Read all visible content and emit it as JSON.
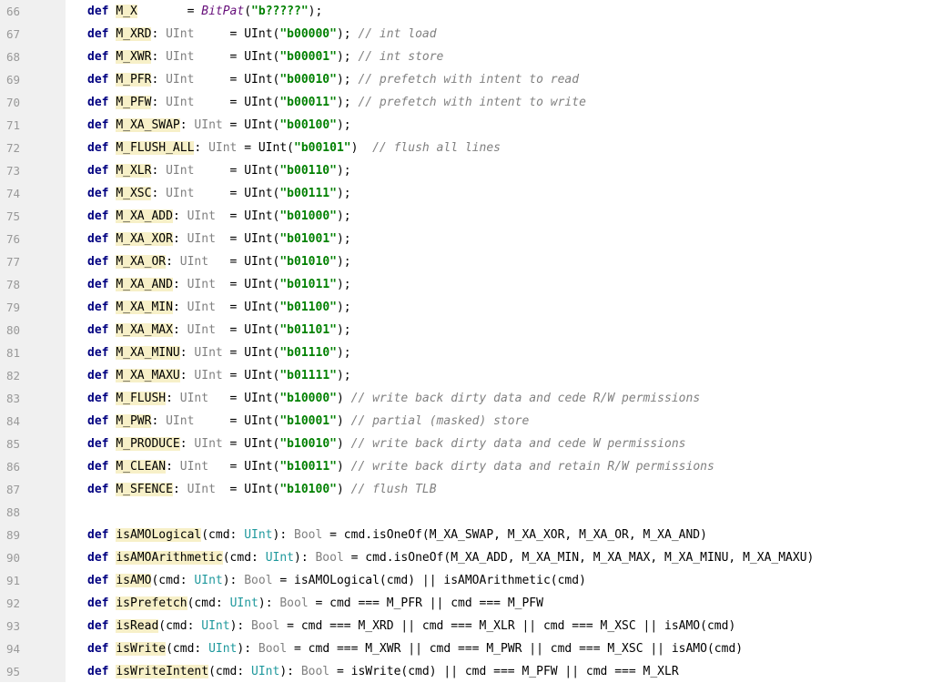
{
  "editor": {
    "first_line_number": 66,
    "lines": [
      [
        [
          "kw",
          "def"
        ],
        [
          "pl",
          " "
        ],
        [
          "id",
          "M_X"
        ],
        [
          "pl",
          "       = "
        ],
        [
          "it",
          "BitPat"
        ],
        [
          "pl",
          "("
        ],
        [
          "str",
          "\"b?????\""
        ],
        [
          "pl",
          ");"
        ]
      ],
      [
        [
          "kw",
          "def"
        ],
        [
          "pl",
          " "
        ],
        [
          "id",
          "M_XRD"
        ],
        [
          "pl",
          ": "
        ],
        [
          "ty",
          "UInt"
        ],
        [
          "pl",
          "     = UInt("
        ],
        [
          "str",
          "\"b00000\""
        ],
        [
          "pl",
          ");"
        ],
        [
          "cmt",
          " // int load"
        ]
      ],
      [
        [
          "kw",
          "def"
        ],
        [
          "pl",
          " "
        ],
        [
          "id",
          "M_XWR"
        ],
        [
          "pl",
          ": "
        ],
        [
          "ty",
          "UInt"
        ],
        [
          "pl",
          "     = UInt("
        ],
        [
          "str",
          "\"b00001\""
        ],
        [
          "pl",
          ");"
        ],
        [
          "cmt",
          " // int store"
        ]
      ],
      [
        [
          "kw",
          "def"
        ],
        [
          "pl",
          " "
        ],
        [
          "id",
          "M_PFR"
        ],
        [
          "pl",
          ": "
        ],
        [
          "ty",
          "UInt"
        ],
        [
          "pl",
          "     = UInt("
        ],
        [
          "str",
          "\"b00010\""
        ],
        [
          "pl",
          ");"
        ],
        [
          "cmt",
          " // prefetch with intent to read"
        ]
      ],
      [
        [
          "kw",
          "def"
        ],
        [
          "pl",
          " "
        ],
        [
          "id",
          "M_PFW"
        ],
        [
          "pl",
          ": "
        ],
        [
          "ty",
          "UInt"
        ],
        [
          "pl",
          "     = UInt("
        ],
        [
          "str",
          "\"b00011\""
        ],
        [
          "pl",
          ");"
        ],
        [
          "cmt",
          " // prefetch with intent to write"
        ]
      ],
      [
        [
          "kw",
          "def"
        ],
        [
          "pl",
          " "
        ],
        [
          "id",
          "M_XA_SWAP"
        ],
        [
          "pl",
          ": "
        ],
        [
          "ty",
          "UInt"
        ],
        [
          "pl",
          " = UInt("
        ],
        [
          "str",
          "\"b00100\""
        ],
        [
          "pl",
          ");"
        ]
      ],
      [
        [
          "kw",
          "def"
        ],
        [
          "pl",
          " "
        ],
        [
          "id",
          "M_FLUSH_ALL"
        ],
        [
          "pl",
          ": "
        ],
        [
          "ty",
          "UInt"
        ],
        [
          "pl",
          " = UInt("
        ],
        [
          "str",
          "\"b00101\""
        ],
        [
          "pl",
          ")"
        ],
        [
          "cmt",
          "  // flush all lines"
        ]
      ],
      [
        [
          "kw",
          "def"
        ],
        [
          "pl",
          " "
        ],
        [
          "id",
          "M_XLR"
        ],
        [
          "pl",
          ": "
        ],
        [
          "ty",
          "UInt"
        ],
        [
          "pl",
          "     = UInt("
        ],
        [
          "str",
          "\"b00110\""
        ],
        [
          "pl",
          ");"
        ]
      ],
      [
        [
          "kw",
          "def"
        ],
        [
          "pl",
          " "
        ],
        [
          "id",
          "M_XSC"
        ],
        [
          "pl",
          ": "
        ],
        [
          "ty",
          "UInt"
        ],
        [
          "pl",
          "     = UInt("
        ],
        [
          "str",
          "\"b00111\""
        ],
        [
          "pl",
          ");"
        ]
      ],
      [
        [
          "kw",
          "def"
        ],
        [
          "pl",
          " "
        ],
        [
          "id",
          "M_XA_ADD"
        ],
        [
          "pl",
          ": "
        ],
        [
          "ty",
          "UInt"
        ],
        [
          "pl",
          "  = UInt("
        ],
        [
          "str",
          "\"b01000\""
        ],
        [
          "pl",
          ");"
        ]
      ],
      [
        [
          "kw",
          "def"
        ],
        [
          "pl",
          " "
        ],
        [
          "id",
          "M_XA_XOR"
        ],
        [
          "pl",
          ": "
        ],
        [
          "ty",
          "UInt"
        ],
        [
          "pl",
          "  = UInt("
        ],
        [
          "str",
          "\"b01001\""
        ],
        [
          "pl",
          ");"
        ]
      ],
      [
        [
          "kw",
          "def"
        ],
        [
          "pl",
          " "
        ],
        [
          "id",
          "M_XA_OR"
        ],
        [
          "pl",
          ": "
        ],
        [
          "ty",
          "UInt"
        ],
        [
          "pl",
          "   = UInt("
        ],
        [
          "str",
          "\"b01010\""
        ],
        [
          "pl",
          ");"
        ]
      ],
      [
        [
          "kw",
          "def"
        ],
        [
          "pl",
          " "
        ],
        [
          "id",
          "M_XA_AND"
        ],
        [
          "pl",
          ": "
        ],
        [
          "ty",
          "UInt"
        ],
        [
          "pl",
          "  = UInt("
        ],
        [
          "str",
          "\"b01011\""
        ],
        [
          "pl",
          ");"
        ]
      ],
      [
        [
          "kw",
          "def"
        ],
        [
          "pl",
          " "
        ],
        [
          "id",
          "M_XA_MIN"
        ],
        [
          "pl",
          ": "
        ],
        [
          "ty",
          "UInt"
        ],
        [
          "pl",
          "  = UInt("
        ],
        [
          "str",
          "\"b01100\""
        ],
        [
          "pl",
          ");"
        ]
      ],
      [
        [
          "kw",
          "def"
        ],
        [
          "pl",
          " "
        ],
        [
          "id",
          "M_XA_MAX"
        ],
        [
          "pl",
          ": "
        ],
        [
          "ty",
          "UInt"
        ],
        [
          "pl",
          "  = UInt("
        ],
        [
          "str",
          "\"b01101\""
        ],
        [
          "pl",
          ");"
        ]
      ],
      [
        [
          "kw",
          "def"
        ],
        [
          "pl",
          " "
        ],
        [
          "id",
          "M_XA_MINU"
        ],
        [
          "pl",
          ": "
        ],
        [
          "ty",
          "UInt"
        ],
        [
          "pl",
          " = UInt("
        ],
        [
          "str",
          "\"b01110\""
        ],
        [
          "pl",
          ");"
        ]
      ],
      [
        [
          "kw",
          "def"
        ],
        [
          "pl",
          " "
        ],
        [
          "id",
          "M_XA_MAXU"
        ],
        [
          "pl",
          ": "
        ],
        [
          "ty",
          "UInt"
        ],
        [
          "pl",
          " = UInt("
        ],
        [
          "str",
          "\"b01111\""
        ],
        [
          "pl",
          ");"
        ]
      ],
      [
        [
          "kw",
          "def"
        ],
        [
          "pl",
          " "
        ],
        [
          "id",
          "M_FLUSH"
        ],
        [
          "pl",
          ": "
        ],
        [
          "ty",
          "UInt"
        ],
        [
          "pl",
          "   = UInt("
        ],
        [
          "str",
          "\"b10000\""
        ],
        [
          "pl",
          ")"
        ],
        [
          "cmt",
          " // write back dirty data and cede R/W permissions"
        ]
      ],
      [
        [
          "kw",
          "def"
        ],
        [
          "pl",
          " "
        ],
        [
          "id",
          "M_PWR"
        ],
        [
          "pl",
          ": "
        ],
        [
          "ty",
          "UInt"
        ],
        [
          "pl",
          "     = UInt("
        ],
        [
          "str",
          "\"b10001\""
        ],
        [
          "pl",
          ")"
        ],
        [
          "cmt",
          " // partial (masked) store"
        ]
      ],
      [
        [
          "kw",
          "def"
        ],
        [
          "pl",
          " "
        ],
        [
          "id",
          "M_PRODUCE"
        ],
        [
          "pl",
          ": "
        ],
        [
          "ty",
          "UInt"
        ],
        [
          "pl",
          " = UInt("
        ],
        [
          "str",
          "\"b10010\""
        ],
        [
          "pl",
          ")"
        ],
        [
          "cmt",
          " // write back dirty data and cede W permissions"
        ]
      ],
      [
        [
          "kw",
          "def"
        ],
        [
          "pl",
          " "
        ],
        [
          "id",
          "M_CLEAN"
        ],
        [
          "pl",
          ": "
        ],
        [
          "ty",
          "UInt"
        ],
        [
          "pl",
          "   = UInt("
        ],
        [
          "str",
          "\"b10011\""
        ],
        [
          "pl",
          ")"
        ],
        [
          "cmt",
          " // write back dirty data and retain R/W permissions"
        ]
      ],
      [
        [
          "kw",
          "def"
        ],
        [
          "pl",
          " "
        ],
        [
          "id",
          "M_SFENCE"
        ],
        [
          "pl",
          ": "
        ],
        [
          "ty",
          "UInt"
        ],
        [
          "pl",
          "  = UInt("
        ],
        [
          "str",
          "\"b10100\""
        ],
        [
          "pl",
          ")"
        ],
        [
          "cmt",
          " // flush TLB"
        ]
      ],
      [],
      [
        [
          "kw",
          "def"
        ],
        [
          "pl",
          " "
        ],
        [
          "id",
          "isAMOLogical"
        ],
        [
          "pl",
          "(cmd: "
        ],
        [
          "tyb",
          "UInt"
        ],
        [
          "pl",
          "): "
        ],
        [
          "ty",
          "Bool"
        ],
        [
          "pl",
          " = cmd.isOneOf(M_XA_SWAP, M_XA_XOR, M_XA_OR, M_XA_AND)"
        ]
      ],
      [
        [
          "kw",
          "def"
        ],
        [
          "pl",
          " "
        ],
        [
          "id",
          "isAMOArithmetic"
        ],
        [
          "pl",
          "(cmd: "
        ],
        [
          "tyb",
          "UInt"
        ],
        [
          "pl",
          "): "
        ],
        [
          "ty",
          "Bool"
        ],
        [
          "pl",
          " = cmd.isOneOf(M_XA_ADD, M_XA_MIN, M_XA_MAX, M_XA_MINU, M_XA_MAXU)"
        ]
      ],
      [
        [
          "kw",
          "def"
        ],
        [
          "pl",
          " "
        ],
        [
          "id",
          "isAMO"
        ],
        [
          "pl",
          "(cmd: "
        ],
        [
          "tyb",
          "UInt"
        ],
        [
          "pl",
          "): "
        ],
        [
          "ty",
          "Bool"
        ],
        [
          "pl",
          " = isAMOLogical(cmd) || isAMOArithmetic(cmd)"
        ]
      ],
      [
        [
          "kw",
          "def"
        ],
        [
          "pl",
          " "
        ],
        [
          "id",
          "isPrefetch"
        ],
        [
          "pl",
          "(cmd: "
        ],
        [
          "tyb",
          "UInt"
        ],
        [
          "pl",
          "): "
        ],
        [
          "ty",
          "Bool"
        ],
        [
          "pl",
          " = cmd === M_PFR || cmd === M_PFW"
        ]
      ],
      [
        [
          "kw",
          "def"
        ],
        [
          "pl",
          " "
        ],
        [
          "id",
          "isRead"
        ],
        [
          "pl",
          "(cmd: "
        ],
        [
          "tyb",
          "UInt"
        ],
        [
          "pl",
          "): "
        ],
        [
          "ty",
          "Bool"
        ],
        [
          "pl",
          " = cmd === M_XRD || cmd === M_XLR || cmd === M_XSC || isAMO(cmd)"
        ]
      ],
      [
        [
          "kw",
          "def"
        ],
        [
          "pl",
          " "
        ],
        [
          "id",
          "isWrite"
        ],
        [
          "pl",
          "(cmd: "
        ],
        [
          "tyb",
          "UInt"
        ],
        [
          "pl",
          "): "
        ],
        [
          "ty",
          "Bool"
        ],
        [
          "pl",
          " = cmd === M_XWR || cmd === M_PWR || cmd === M_XSC || isAMO(cmd)"
        ]
      ],
      [
        [
          "kw",
          "def"
        ],
        [
          "pl",
          " "
        ],
        [
          "id",
          "isWriteIntent"
        ],
        [
          "pl",
          "(cmd: "
        ],
        [
          "tyb",
          "UInt"
        ],
        [
          "pl",
          "): "
        ],
        [
          "ty",
          "Bool"
        ],
        [
          "pl",
          " = isWrite(cmd) || cmd === M_PFW || cmd === M_XLR"
        ]
      ]
    ]
  }
}
